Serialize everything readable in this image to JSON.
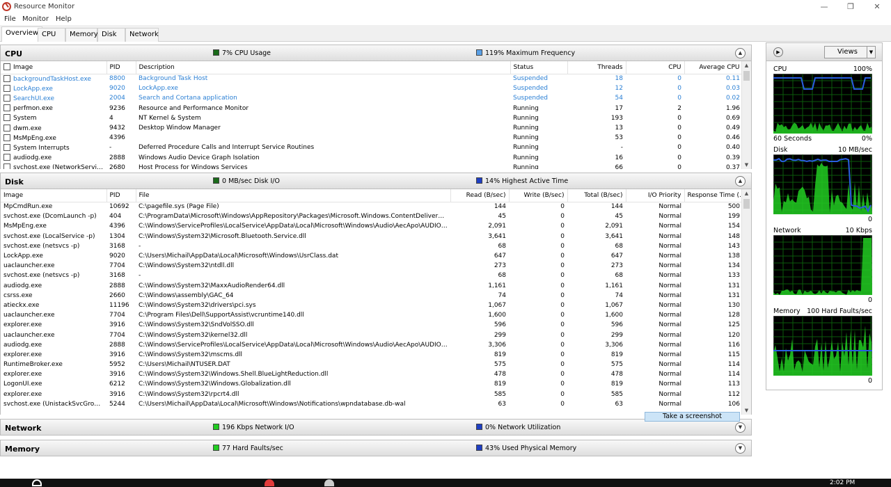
{
  "window": {
    "title": "Resource Monitor",
    "minimize": "—",
    "maximize": "❐",
    "close": "✕"
  },
  "menu": [
    "File",
    "Monitor",
    "Help"
  ],
  "tabs": [
    "Overview",
    "CPU",
    "Memory",
    "Disk",
    "Network"
  ],
  "colors": {
    "green": "#00b050",
    "darkgreen": "#1a6b1a",
    "blue": "#1f3fc4",
    "lightblue": "#5aa0e6",
    "link": "#2a7fd4"
  },
  "cpu": {
    "title": "CPU",
    "stat1": "7% CPU Usage",
    "stat2": "119% Maximum Frequency",
    "columns": [
      "Image",
      "PID",
      "Description",
      "Status",
      "Threads",
      "CPU",
      "Average CPU"
    ],
    "rows": [
      [
        "backgroundTaskHost.exe",
        "8800",
        "Background Task Host",
        "Suspended",
        "18",
        "0",
        "0.11"
      ],
      [
        "LockApp.exe",
        "9020",
        "LockApp.exe",
        "Suspended",
        "12",
        "0",
        "0.03"
      ],
      [
        "SearchUI.exe",
        "2004",
        "Search and Cortana application",
        "Suspended",
        "54",
        "0",
        "0.02"
      ],
      [
        "perfmon.exe",
        "9236",
        "Resource and Performance Monitor",
        "Running",
        "17",
        "2",
        "1.96"
      ],
      [
        "System",
        "4",
        "NT Kernel & System",
        "Running",
        "193",
        "0",
        "0.69"
      ],
      [
        "dwm.exe",
        "9432",
        "Desktop Window Manager",
        "Running",
        "13",
        "0",
        "0.49"
      ],
      [
        "MsMpEng.exe",
        "4396",
        "",
        "Running",
        "53",
        "0",
        "0.46"
      ],
      [
        "System Interrupts",
        "-",
        "Deferred Procedure Calls and Interrupt Service Routines",
        "Running",
        "-",
        "0",
        "0.40"
      ],
      [
        "audiodg.exe",
        "2888",
        "Windows Audio Device Graph Isolation",
        "Running",
        "16",
        "0",
        "0.39"
      ],
      [
        "svchost.exe (NetworkService -p)",
        "2680",
        "Host Process for Windows Services",
        "Running",
        "66",
        "0",
        "0.37"
      ]
    ]
  },
  "disk": {
    "title": "Disk",
    "stat1": "0 MB/sec Disk I/O",
    "stat2": "14% Highest Active Time",
    "columns": [
      "Image",
      "PID",
      "File",
      "Read (B/sec)",
      "Write (B/sec)",
      "Total (B/sec)",
      "I/O Priority",
      "Response Time (..."
    ],
    "rows": [
      [
        "MpCmdRun.exe",
        "10692",
        "C:\\pagefile.sys (Page File)",
        "144",
        "0",
        "144",
        "Normal",
        "500"
      ],
      [
        "svchost.exe (DcomLaunch -p)",
        "404",
        "C:\\ProgramData\\Microsoft\\Windows\\AppRepository\\Packages\\Microsoft.Windows.ContentDeliveryManager_10.0....",
        "45",
        "0",
        "45",
        "Normal",
        "199"
      ],
      [
        "MsMpEng.exe",
        "4396",
        "C:\\Windows\\ServiceProfiles\\LocalService\\AppData\\Local\\Microsoft\\Windows\\Audio\\AecApo\\AUDIODG_{0.0.1.000....",
        "2,091",
        "0",
        "2,091",
        "Normal",
        "154"
      ],
      [
        "svchost.exe (LocalService -p)",
        "1304",
        "C:\\Windows\\System32\\Microsoft.Bluetooth.Service.dll",
        "3,641",
        "0",
        "3,641",
        "Normal",
        "148"
      ],
      [
        "svchost.exe (netsvcs -p)",
        "3168",
        "-",
        "68",
        "0",
        "68",
        "Normal",
        "143"
      ],
      [
        "LockApp.exe",
        "9020",
        "C:\\Users\\Michail\\AppData\\Local\\Microsoft\\Windows\\UsrClass.dat",
        "647",
        "0",
        "647",
        "Normal",
        "138"
      ],
      [
        "uaclauncher.exe",
        "7704",
        "C:\\Windows\\System32\\ntdll.dll",
        "273",
        "0",
        "273",
        "Normal",
        "134"
      ],
      [
        "svchost.exe (netsvcs -p)",
        "3168",
        "-",
        "68",
        "0",
        "68",
        "Normal",
        "133"
      ],
      [
        "audiodg.exe",
        "2888",
        "C:\\Windows\\System32\\MaxxAudioRender64.dll",
        "1,161",
        "0",
        "1,161",
        "Normal",
        "131"
      ],
      [
        "csrss.exe",
        "2660",
        "C:\\Windows\\assembly\\GAC_64",
        "74",
        "0",
        "74",
        "Normal",
        "131"
      ],
      [
        "atieckx.exe",
        "11196",
        "C:\\Windows\\System32\\drivers\\pci.sys",
        "1,067",
        "0",
        "1,067",
        "Normal",
        "130"
      ],
      [
        "uaclauncher.exe",
        "7704",
        "C:\\Program Files\\Dell\\SupportAssist\\vcruntime140.dll",
        "1,600",
        "0",
        "1,600",
        "Normal",
        "128"
      ],
      [
        "explorer.exe",
        "3916",
        "C:\\Windows\\System32\\SndVolSSO.dll",
        "596",
        "0",
        "596",
        "Normal",
        "125"
      ],
      [
        "uaclauncher.exe",
        "7704",
        "C:\\Windows\\System32\\kernel32.dll",
        "299",
        "0",
        "299",
        "Normal",
        "120"
      ],
      [
        "audiodg.exe",
        "2888",
        "C:\\Windows\\ServiceProfiles\\LocalService\\AppData\\Local\\Microsoft\\Windows\\Audio\\AecApo\\AUDIODG_{0.0.1.000....",
        "3,306",
        "0",
        "3,306",
        "Normal",
        "116"
      ],
      [
        "explorer.exe",
        "3916",
        "C:\\Windows\\System32\\mscms.dll",
        "819",
        "0",
        "819",
        "Normal",
        "115"
      ],
      [
        "RuntimeBroker.exe",
        "5952",
        "C:\\Users\\Michail\\NTUSER.DAT",
        "575",
        "0",
        "575",
        "Normal",
        "114"
      ],
      [
        "explorer.exe",
        "3916",
        "C:\\Windows\\System32\\Windows.Shell.BlueLightReduction.dll",
        "478",
        "0",
        "478",
        "Normal",
        "114"
      ],
      [
        "LogonUI.exe",
        "6212",
        "C:\\Windows\\System32\\Windows.Globalization.dll",
        "819",
        "0",
        "819",
        "Normal",
        "113"
      ],
      [
        "explorer.exe",
        "3916",
        "C:\\Windows\\System32\\rpcrt4.dll",
        "585",
        "0",
        "585",
        "Normal",
        "112"
      ],
      [
        "svchost.exe (UnistackSvcGroup)",
        "5244",
        "C:\\Users\\Michail\\AppData\\Local\\Microsoft\\Windows\\Notifications\\wpndatabase.db-wal",
        "63",
        "0",
        "63",
        "Normal",
        "106"
      ]
    ]
  },
  "network": {
    "title": "Network",
    "stat1": "196 Kbps Network I/O",
    "stat2": "0% Network Utilization"
  },
  "memory": {
    "title": "Memory",
    "stat1": "77 Hard Faults/sec",
    "stat2": "43% Used Physical Memory"
  },
  "tooltip": "Take a screenshot",
  "rightpane": {
    "views_label": "Views",
    "graphs": [
      {
        "label": "CPU",
        "max": "100%",
        "bottom_left": "60 Seconds",
        "bottom_right": "0%"
      },
      {
        "label": "Disk",
        "max": "10 MB/sec",
        "bottom_left": "",
        "bottom_right": "0"
      },
      {
        "label": "Network",
        "max": "10 Kbps",
        "bottom_left": "",
        "bottom_right": "0"
      },
      {
        "label": "Memory",
        "max": "100 Hard Faults/sec",
        "bottom_left": "",
        "bottom_right": "0"
      }
    ]
  },
  "taskbar": {
    "time": "2:02 PM"
  }
}
